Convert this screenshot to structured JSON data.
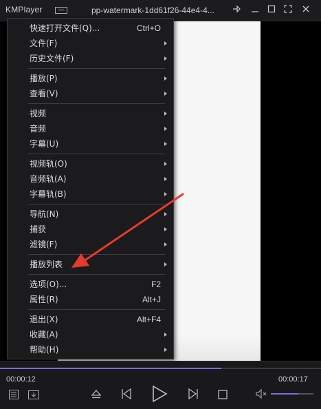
{
  "titlebar": {
    "app_name": "KMPlayer",
    "file_title": "pp-watermark-1dd61f26-44e4-4..."
  },
  "menu": {
    "items": [
      {
        "label": "快速打开文件(Q)...",
        "shortcut": "Ctrl+O",
        "submenu": false
      },
      {
        "label": "文件(F)",
        "shortcut": "",
        "submenu": true
      },
      {
        "label": "历史文件(F)",
        "shortcut": "",
        "submenu": true
      },
      {
        "separator": true
      },
      {
        "label": "播放(P)",
        "shortcut": "",
        "submenu": true
      },
      {
        "label": "查看(V)",
        "shortcut": "",
        "submenu": true
      },
      {
        "separator": true
      },
      {
        "label": "视频",
        "shortcut": "",
        "submenu": true
      },
      {
        "label": "音频",
        "shortcut": "",
        "submenu": true
      },
      {
        "label": "字幕(U)",
        "shortcut": "",
        "submenu": true
      },
      {
        "separator": true
      },
      {
        "label": "视频轨(O)",
        "shortcut": "",
        "submenu": true
      },
      {
        "label": "音频轨(A)",
        "shortcut": "",
        "submenu": true
      },
      {
        "label": "字幕轨(B)",
        "shortcut": "",
        "submenu": true
      },
      {
        "separator": true
      },
      {
        "label": "导航(N)",
        "shortcut": "",
        "submenu": true
      },
      {
        "label": "捕获",
        "shortcut": "",
        "submenu": true
      },
      {
        "label": "滤镜(F)",
        "shortcut": "",
        "submenu": true
      },
      {
        "separator": true
      },
      {
        "label": "播放列表",
        "shortcut": "",
        "submenu": true
      },
      {
        "separator": true
      },
      {
        "label": "选项(O)...",
        "shortcut": "F2",
        "submenu": false
      },
      {
        "label": "属性(R)",
        "shortcut": "Alt+J",
        "submenu": false
      },
      {
        "separator": true
      },
      {
        "label": "退出(X)",
        "shortcut": "Alt+F4",
        "submenu": false
      },
      {
        "label": "收藏(A)",
        "shortcut": "",
        "submenu": true
      },
      {
        "label": "帮助(H)",
        "shortcut": "",
        "submenu": true
      }
    ]
  },
  "annotation": {
    "color": "#e53b2c",
    "points_to": "播放列表"
  },
  "controls": {
    "current_time": "00:00:12",
    "total_time": "00:00:17",
    "seek_progress": 0.69,
    "volume_level": 0.65,
    "accent": "#7f6ae0",
    "buttons": [
      "playlist-icon",
      "open-folder-icon",
      "eject-icon",
      "previous-icon",
      "play-icon",
      "next-icon",
      "stop-icon",
      "mute-icon"
    ]
  }
}
